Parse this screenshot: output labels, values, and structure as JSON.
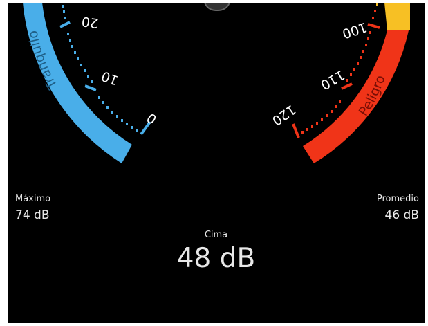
{
  "gauge": {
    "left_zone": {
      "label": "Tranquilo",
      "color": "#49aee9"
    },
    "right_zone": {
      "label": "Peligro",
      "color": "#f03418"
    },
    "top_zone": {
      "color": "#f7c024"
    },
    "left_ticks": [
      "0",
      "10",
      "20"
    ],
    "right_ticks": [
      "100",
      "110",
      "120"
    ],
    "tick_color_left": "#49aee9",
    "tick_color_right": "#f03418"
  },
  "stats": {
    "max": {
      "label": "Máximo",
      "value": "74 dB"
    },
    "average": {
      "label": "Promedio",
      "value": "46 dB"
    },
    "peak": {
      "label": "Cima",
      "value": "48 dB"
    }
  }
}
